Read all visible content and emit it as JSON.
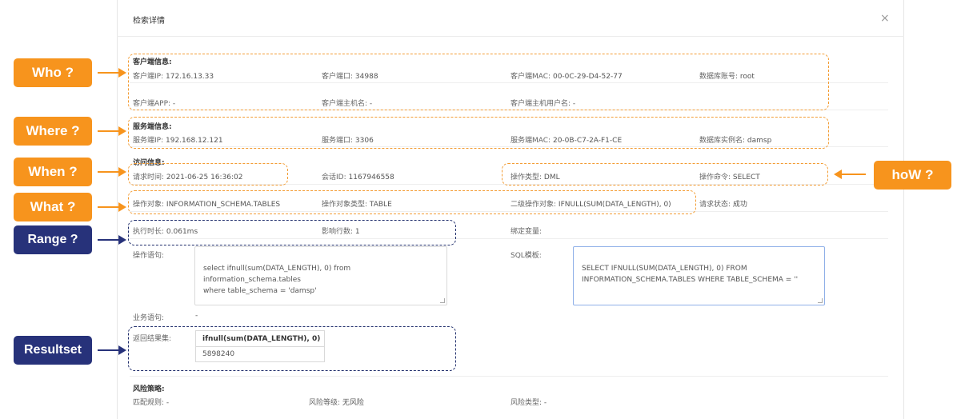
{
  "modal": {
    "title": "检索详情",
    "close": "×"
  },
  "client": {
    "section": "客户端信息:",
    "ip_label": "客户端IP:",
    "ip": "172.16.13.33",
    "port_label": "客户端口:",
    "port": "34988",
    "mac_label": "客户端MAC:",
    "mac": "00-0C-29-D4-52-77",
    "account_label": "数据库账号:",
    "account": "root",
    "app_label": "客户端APP:",
    "app": "-",
    "host_label": "客户端主机名:",
    "host": "-",
    "host_user_label": "客户端主机用户名:",
    "host_user": "-"
  },
  "server": {
    "section": "服务端信息:",
    "ip_label": "服务端IP:",
    "ip": "192.168.12.121",
    "port_label": "服务端口:",
    "port": "3306",
    "mac_label": "服务端MAC:",
    "mac": "20-0B-C7-2A-F1-CE",
    "instance_label": "数据库实例名:",
    "instance": "damsp"
  },
  "access": {
    "section": "访问信息:",
    "time_label": "请求时间:",
    "time": "2021-06-25 16:36:02",
    "session_label": "会话ID:",
    "session": "1167946558",
    "optype_label": "操作类型:",
    "optype": "DML",
    "cmd_label": "操作命令:",
    "cmd": "SELECT",
    "object_label": "操作对象:",
    "object": "INFORMATION_SCHEMA.TABLES",
    "object_type_label": "操作对象类型:",
    "object_type": "TABLE",
    "second_object_label": "二级操作对象:",
    "second_object": "IFNULL(SUM(DATA_LENGTH), 0)",
    "status_label": "请求状态:",
    "status": "成功",
    "duration_label": "执行时长:",
    "duration": "0.061ms",
    "rows_label": "影响行数:",
    "rows": "1",
    "bind_label": "绑定变量:",
    "bind": "",
    "stmt_label": "操作语句:",
    "stmt": "select ifnull(sum(DATA_LENGTH), 0) from information_schema.tables\nwhere table_schema = 'damsp'",
    "sql_template_label": "SQL模板:",
    "sql_template": "SELECT IFNULL(SUM(DATA_LENGTH), 0) FROM\nINFORMATION_SCHEMA.TABLES WHERE TABLE_SCHEMA = ''",
    "business_label": "业务语句:",
    "business": "-",
    "result_label": "返回结果集:",
    "result_header": "ifnull(sum(DATA_LENGTH), 0)",
    "result_value": "5898240"
  },
  "risk": {
    "section": "风险策略:",
    "rule_label": "匹配规则:",
    "rule": "-",
    "level_label": "风险等级:",
    "level": "无风险",
    "type_label": "风险类型:",
    "type": "-"
  },
  "annotations": {
    "who": "Who ?",
    "where": "Where ?",
    "when": "When ?",
    "what": "What ?",
    "range": "Range ?",
    "resultset": "Resultset",
    "how": "hoW ?"
  },
  "colors": {
    "orange": "#f7941d",
    "navy": "#27327a"
  }
}
